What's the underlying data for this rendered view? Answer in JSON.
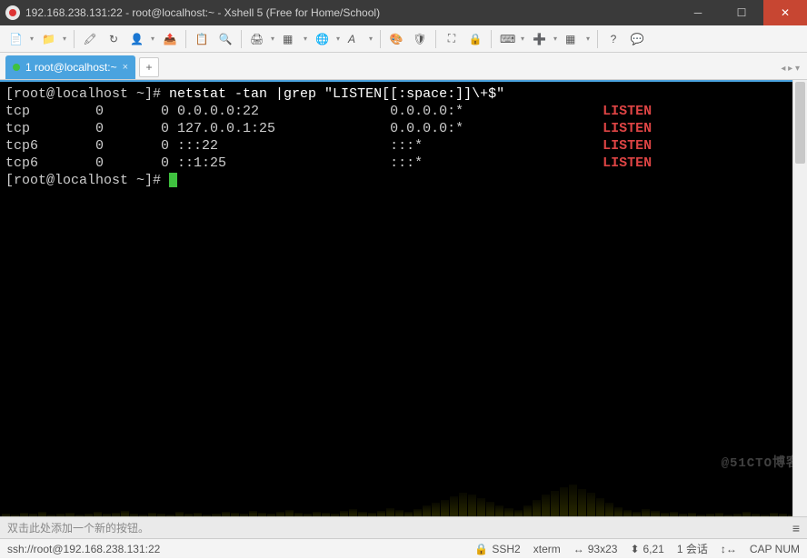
{
  "window": {
    "title": "192.168.238.131:22 - root@localhost:~ - Xshell 5 (Free for Home/School)"
  },
  "tab": {
    "label": "1 root@localhost:~"
  },
  "terminal": {
    "prompt": "[root@localhost ~]# ",
    "cmd": "netstat -tan |grep \"LISTEN[[:space:]]\\+$\"",
    "rows": [
      {
        "proto": "tcp",
        "rq": "0",
        "sq": "0",
        "local": "0.0.0.0:22",
        "foreign": "0.0.0.0:*",
        "state": "LISTEN"
      },
      {
        "proto": "tcp",
        "rq": "0",
        "sq": "0",
        "local": "127.0.0.1:25",
        "foreign": "0.0.0.0:*",
        "state": "LISTEN"
      },
      {
        "proto": "tcp6",
        "rq": "0",
        "sq": "0",
        "local": ":::22",
        "foreign": ":::*",
        "state": "LISTEN"
      },
      {
        "proto": "tcp6",
        "rq": "0",
        "sq": "0",
        "local": "::1:25",
        "foreign": ":::*",
        "state": "LISTEN"
      }
    ],
    "prompt2": "[root@localhost ~]# "
  },
  "hint": "双击此处添加一个新的按钮。",
  "status": {
    "uri": "ssh://root@192.168.238.131:22",
    "proto": "SSH2",
    "term": "xterm",
    "size": "93x23",
    "cursor": "6,21",
    "sess": "1 会话",
    "caps": "CAP  NUM"
  },
  "watermark": "@51CTO博客",
  "icons": {
    "lock": "🔒",
    "globe": "🌐",
    "search": "🔍",
    "copy": "📋",
    "paste": "📄",
    "print": "🖨",
    "font": "A",
    "color": "🎨",
    "shield": "🛡",
    "reconnect": "↻",
    "full": "⛶",
    "folder": "📁",
    "new": "➕",
    "help": "?",
    "chat": "💬",
    "dash": "▭",
    "grid": "▦",
    "keyboard": "⌨",
    "arrows": "↕↔"
  }
}
